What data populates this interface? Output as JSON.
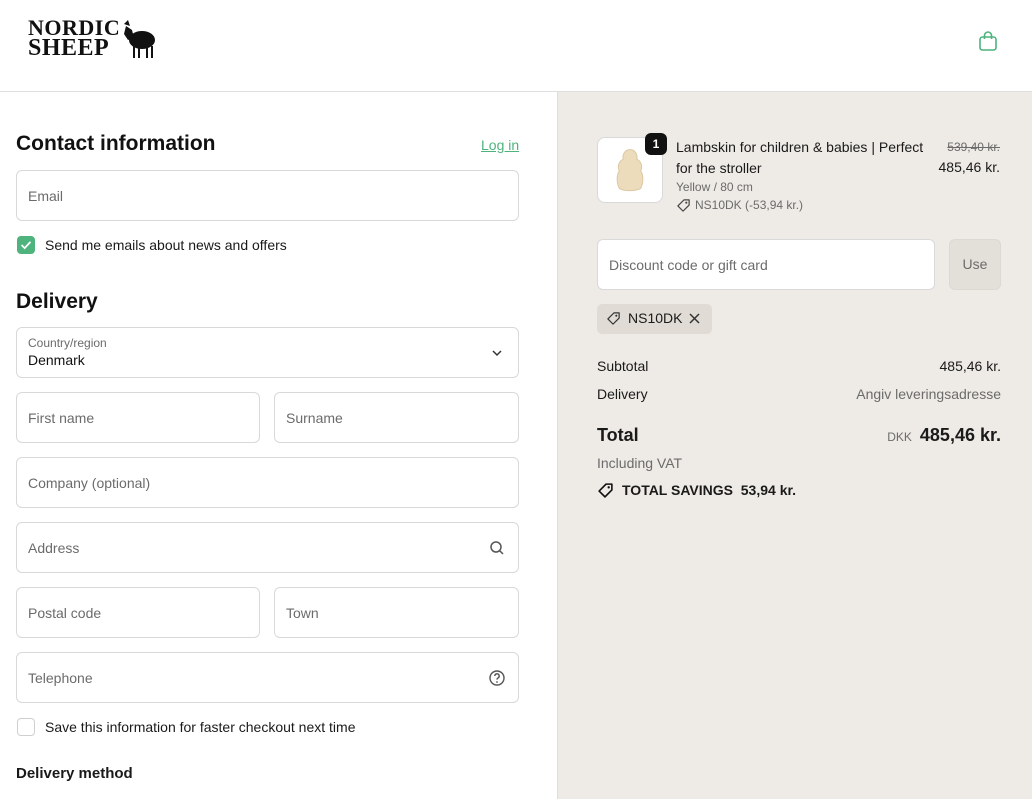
{
  "brand": {
    "line1": "NORDIC",
    "line2": "SHEEP"
  },
  "contact": {
    "title": "Contact information",
    "login_label": "Log in",
    "email_placeholder": "Email",
    "newsletter_label": "Send me emails about news and offers"
  },
  "delivery": {
    "title": "Delivery",
    "country_label": "Country/region",
    "country_value": "Denmark",
    "first_name_placeholder": "First name",
    "surname_placeholder": "Surname",
    "company_placeholder": "Company (optional)",
    "address_placeholder": "Address",
    "postal_placeholder": "Postal code",
    "town_placeholder": "Town",
    "telephone_placeholder": "Telephone",
    "save_info_label": "Save this information for faster checkout next time",
    "method_title": "Delivery method"
  },
  "order": {
    "item": {
      "quantity": "1",
      "title": "Lambskin for children & babies | Perfect for the stroller",
      "variant": "Yellow / 80 cm",
      "discount": "NS10DK (-53,94 kr.)",
      "price_original": "539,40 kr.",
      "price": "485,46 kr."
    },
    "discount_placeholder": "Discount code or gift card",
    "use_label": "Use",
    "applied_code": "NS10DK",
    "subtotal_label": "Subtotal",
    "subtotal_value": "485,46 kr.",
    "delivery_label": "Delivery",
    "delivery_value": "Angiv leveringsadresse",
    "total_label": "Total",
    "currency": "DKK",
    "total_value": "485,46 kr.",
    "vat_label": "Including VAT",
    "savings_label": "TOTAL SAVINGS",
    "savings_value": "53,94 kr."
  },
  "colors": {
    "accent": "#4eb37c",
    "summary_bg": "#eeebe6",
    "border": "#d9d9d9"
  }
}
